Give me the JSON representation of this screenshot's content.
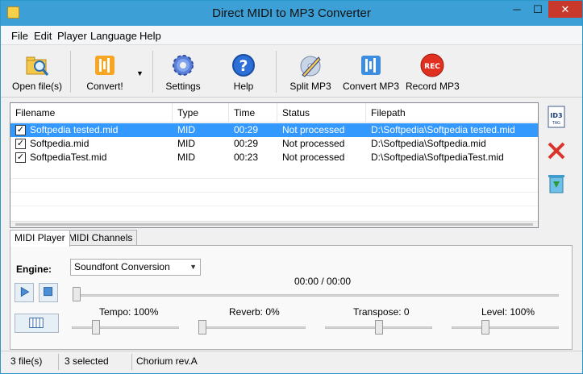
{
  "window": {
    "title": "Direct MIDI to MP3 Converter",
    "min": "─",
    "max": "☐",
    "close": "✕"
  },
  "menu": [
    "File",
    "Edit",
    "Player",
    "Language",
    "Help"
  ],
  "toolbar": {
    "open": "Open file(s)",
    "convert": "Convert!",
    "settings": "Settings",
    "help": "Help",
    "split": "Split MP3",
    "convert_mp3": "Convert MP3",
    "record": "Record MP3",
    "record_badge": "REC"
  },
  "files": {
    "columns": [
      "Filename",
      "Type",
      "Time",
      "Status",
      "Filepath"
    ],
    "rows": [
      {
        "checked": true,
        "filename": "Softpedia tested.mid",
        "type": "MID",
        "time": "00:29",
        "status": "Not processed",
        "path": "D:\\Softpedia\\Softpedia tested.mid",
        "selected": true
      },
      {
        "checked": true,
        "filename": "Softpedia.mid",
        "type": "MID",
        "time": "00:29",
        "status": "Not processed",
        "path": "D:\\Softpedia\\Softpedia.mid",
        "selected": false
      },
      {
        "checked": true,
        "filename": "SoftpediaTest.mid",
        "type": "MID",
        "time": "00:23",
        "status": "Not processed",
        "path": "D:\\Softpedia\\SoftpediaTest.mid",
        "selected": false
      }
    ]
  },
  "tabs": [
    "MIDI Player",
    "MIDI Channels"
  ],
  "player": {
    "engine_label": "Engine:",
    "engine_value": "Soundfont Conversion",
    "time": "00:00 / 00:00",
    "position": 0,
    "tempo": {
      "label": "Tempo: 100%",
      "value": 0.2
    },
    "reverb": {
      "label": "Reverb: 0%",
      "value": 0.0
    },
    "transpose": {
      "label": "Transpose: 0",
      "value": 0.5
    },
    "level": {
      "label": "Level: 100%",
      "value": 0.3
    }
  },
  "status": {
    "files": "3 file(s)",
    "selected": "3 selected",
    "soundfont": "Chorium rev.A"
  },
  "colors": {
    "titlebar": "#3c9fd6",
    "selection": "#3399ff",
    "close": "#c8392b",
    "rec": "#e03020"
  }
}
